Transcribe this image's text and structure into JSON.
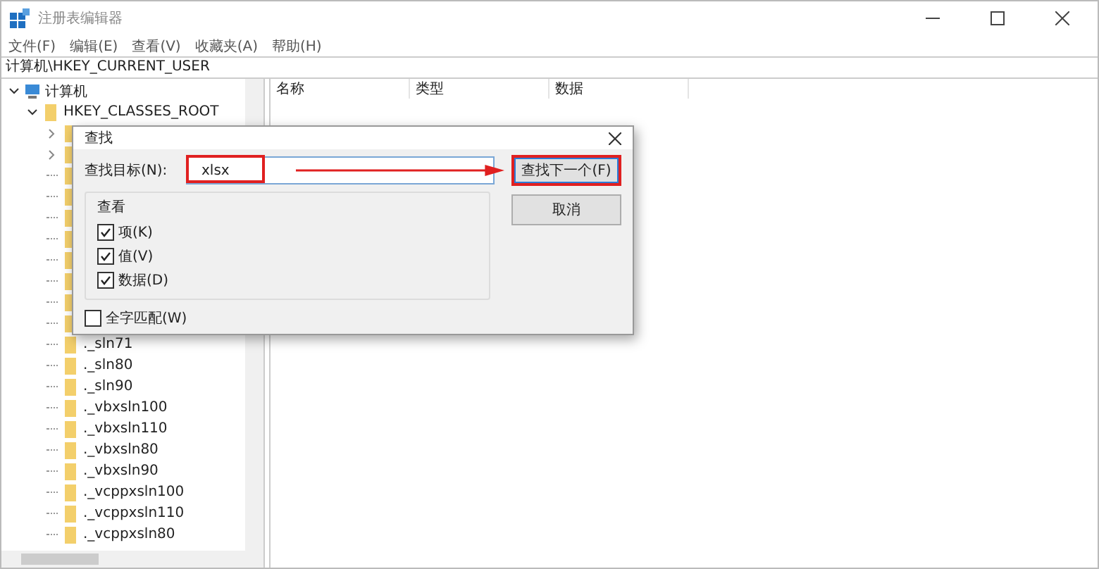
{
  "window": {
    "title": "注册表编辑器"
  },
  "menu": [
    "文件(F)",
    "编辑(E)",
    "查看(V)",
    "收藏夹(A)",
    "帮助(H)"
  ],
  "address": "计算机\\HKEY_CURRENT_USER",
  "tree": [
    {
      "label": "计算机",
      "kind": "computer",
      "expanded": true,
      "children": [
        {
          "label": "HKEY_CLASSES_ROOT",
          "kind": "folder",
          "expanded": true,
          "children": [
            {
              "label": "._sln71",
              "kind": "folder"
            },
            {
              "label": "._sln80",
              "kind": "folder"
            },
            {
              "label": "._sln90",
              "kind": "folder"
            },
            {
              "label": "._vbxsln100",
              "kind": "folder"
            },
            {
              "label": "._vbxsln110",
              "kind": "folder"
            },
            {
              "label": "._vbxsln80",
              "kind": "folder"
            },
            {
              "label": "._vbxsln90",
              "kind": "folder"
            },
            {
              "label": "._vcppxsln100",
              "kind": "folder"
            },
            {
              "label": "._vcppxsln110",
              "kind": "folder"
            },
            {
              "label": "._vcppxsln80",
              "kind": "folder"
            }
          ]
        }
      ]
    }
  ],
  "columns": [
    "名称",
    "类型",
    "数据"
  ],
  "dialog": {
    "title": "查找",
    "target_label": "查找目标(N):",
    "target_value": "xlsx",
    "buttons": [
      {
        "label": "查找下一个(F)",
        "highlighted": true
      },
      {
        "label": "取消",
        "highlighted": false
      }
    ],
    "group_title": "查看",
    "options": [
      {
        "label": "项(K)",
        "checked": true
      },
      {
        "label": "值(V)",
        "checked": true
      },
      {
        "label": "数据(D)",
        "checked": true
      }
    ],
    "whole_word": {
      "label": "全字匹配(W)",
      "checked": false
    }
  }
}
